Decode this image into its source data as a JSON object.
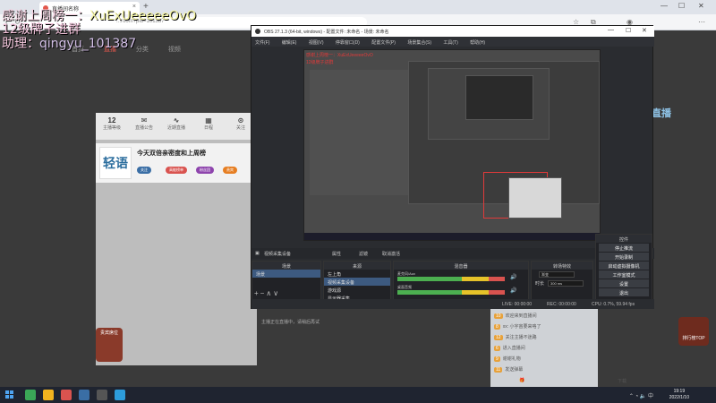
{
  "browser": {
    "tab_title": "直播间名称",
    "new_tab": "+",
    "url": "...room?pid=101387",
    "window_controls": [
      "—",
      "☐",
      "✕"
    ]
  },
  "overlay": {
    "line1_prefix": "感谢上周榜一：",
    "line1_name": "XuExUeeeeeOvO",
    "line2": "12级牌子进群",
    "line3_prefix": "助理：",
    "line3_name": "qingyu_101387"
  },
  "site": {
    "nav": [
      "首页",
      "直播",
      "分类",
      "视频"
    ],
    "active_nav_index": 1,
    "stats": [
      {
        "value": "12",
        "label": "主播等级"
      },
      {
        "value": "",
        "label": "直播公告"
      },
      {
        "value": "",
        "label": "近期直播"
      },
      {
        "value": "",
        "label": "日程"
      },
      {
        "value": "",
        "label": "关注"
      }
    ],
    "room_logo": "轻语",
    "room_title": "今天双倍亲密度和上周榜",
    "pills": [
      "关注",
      "高能榜单",
      "粉丝团",
      "贵宾"
    ],
    "badge_mini": "贵宾席位",
    "right_logo": "直播",
    "right_banner": "排行榜TOP"
  },
  "obs": {
    "title": "OBS 27.1.3 (64-bit, windows) - 配置文件: 未命名 - 场景: 未命名",
    "menu": [
      "文件(F)",
      "编辑(E)",
      "视图(V)",
      "停靠窗口(D)",
      "配置文件(P)",
      "场景集合(S)",
      "工具(T)",
      "帮助(H)"
    ],
    "window_controls": [
      "—",
      "☐",
      "✕"
    ],
    "preview_text1": "感谢上周榜一：XuExUeeeeeOvO",
    "preview_text2": "12级牌子进群",
    "tabbar": {
      "source_label": "视频采集设备",
      "props": "属性",
      "filters": "滤镜",
      "deactivate": "取消激活"
    },
    "docks": {
      "scenes": {
        "title": "场景",
        "items": [
          "场景"
        ]
      },
      "sources": {
        "title": "来源",
        "items": [
          "左上角",
          "视频采集设备",
          "游戏源",
          "显示器采集"
        ]
      },
      "mixer": {
        "title": "混音器",
        "channels": [
          {
            "name": "麦克风/Aux"
          },
          {
            "name": "桌面音频"
          }
        ]
      },
      "transitions": {
        "title": "转场特效",
        "type_label": "渐变",
        "duration_label": "时长",
        "duration_value": "300 ms"
      },
      "controls": {
        "title": "控件",
        "buttons": [
          "停止推流",
          "开始录制",
          "启动虚拟摄像机",
          "工作室模式",
          "设置",
          "退出"
        ]
      }
    },
    "status": {
      "live": "LIVE: 00:00:00",
      "rec": "REC: 00:00:00",
      "cpu": "CPU: 0.7%, 59.94 fps"
    },
    "bottom_hint": "主播正在直播中，请稍后再试"
  },
  "chat": {
    "lines": [
      {
        "lvl": "12",
        "text": "XuEx: 哈哈"
      },
      {
        "lvl": "10",
        "text": "欢迎来到直播间"
      },
      {
        "lvl": "8",
        "text": "xx: 小宇宙要来咯了"
      },
      {
        "lvl": "12",
        "text": "关注主播不迷路"
      },
      {
        "lvl": "6",
        "text": "进入直播间"
      },
      {
        "lvl": "9",
        "text": "谢谢礼物"
      },
      {
        "lvl": "11",
        "text": "发送弹幕"
      }
    ],
    "gift_label": "下载"
  },
  "taskbar": {
    "time": "19:19",
    "date": "2022/1/10",
    "apps": [
      {
        "name": "edge-browser",
        "color": "#3aa757"
      },
      {
        "name": "explorer",
        "color": "#f2b31f"
      },
      {
        "name": "media-app",
        "color": "#d9534f"
      },
      {
        "name": "steam",
        "color": "#3a6ea5"
      },
      {
        "name": "obs",
        "color": "#555555"
      },
      {
        "name": "other-app",
        "color": "#2d9cdb"
      }
    ]
  }
}
